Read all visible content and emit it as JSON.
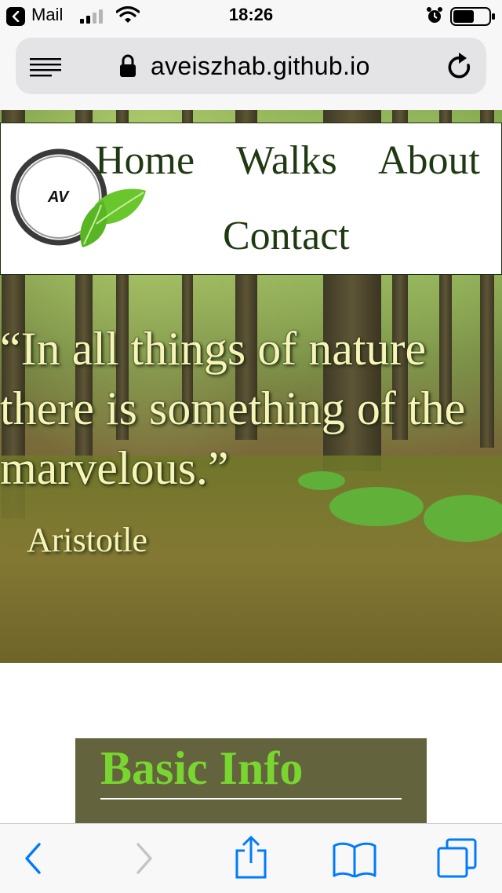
{
  "status_bar": {
    "back_app": "Mail",
    "time": "18:26",
    "icons": [
      "back-arrow-icon",
      "signal-icon",
      "wifi-icon",
      "alarm-icon",
      "battery-icon"
    ]
  },
  "browser": {
    "url": "aveiszhab.github.io",
    "icons": [
      "menu-icon",
      "lock-icon",
      "reload-icon"
    ]
  },
  "nav": {
    "logo_text": "AV",
    "links": [
      "Home",
      "Walks",
      "About",
      "Contact"
    ]
  },
  "hero": {
    "quote": [
      "“In all things of nature",
      "there is something of the",
      "marvelous.”"
    ],
    "author": "Aristotle"
  },
  "section": {
    "heading": "Basic Info"
  },
  "toolbar": {
    "icons": [
      "back-icon",
      "forward-icon",
      "share-icon",
      "bookmarks-icon",
      "tabs-icon"
    ]
  },
  "colors": {
    "nav_text": "#1f3a12",
    "quote_text": "#f7f4b8",
    "section_bg": "#63633d",
    "section_heading": "#79d52f",
    "ios_blue": "#007aff"
  }
}
